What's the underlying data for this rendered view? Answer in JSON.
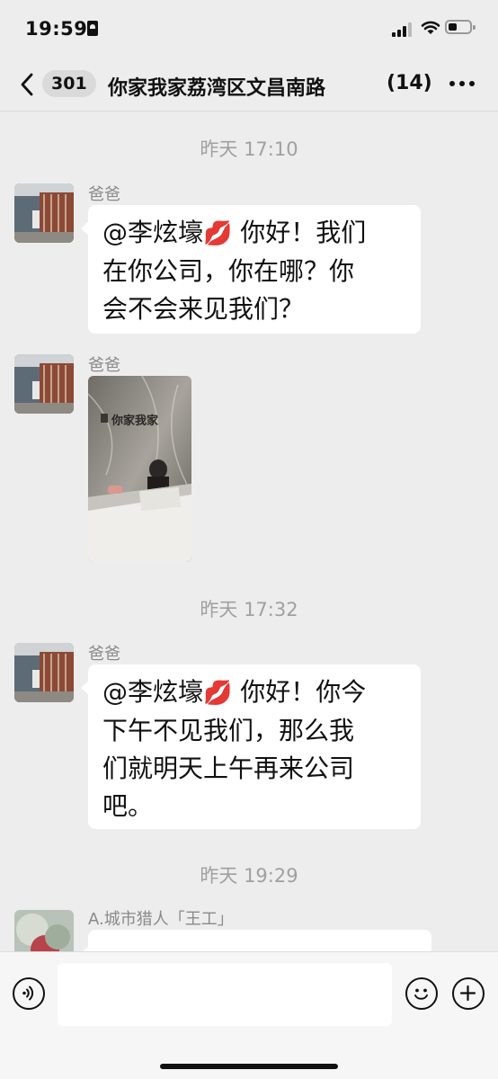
{
  "status_bar": {
    "time": "19:59"
  },
  "nav": {
    "back_count": "301",
    "title": "你家我家荔湾区文昌南路",
    "member_count": "(14)"
  },
  "messages": [
    {
      "timestamp": "昨天 17:10",
      "sender": "爸爸",
      "mention": "@李炫壕",
      "emoji": "💋",
      "lines": [
        "你好！我们",
        "在你公司，你在哪？你",
        "会不会来见我们？"
      ]
    },
    {
      "sender": "爸爸",
      "image_sign": "你家我家"
    },
    {
      "timestamp": "昨天 17:32",
      "sender": "爸爸",
      "mention": "@李炫壕",
      "emoji": "💋",
      "lines": [
        "你好！你今",
        "下午不见我们，那么我",
        "们就明天上午再来公司",
        "吧。"
      ]
    },
    {
      "timestamp": "昨天 19:29",
      "sender": "A.城市猎人「王工」"
    }
  ],
  "icons": [
    "back-chevron-icon",
    "more-icon",
    "voice-icon",
    "emoji-icon",
    "plus-icon",
    "signal-icon",
    "wifi-icon",
    "battery-icon"
  ],
  "colors": {
    "background": "#ededed",
    "bubble": "#ffffff",
    "timestamp": "#a0a0a0",
    "sender": "#8a8a8a"
  }
}
